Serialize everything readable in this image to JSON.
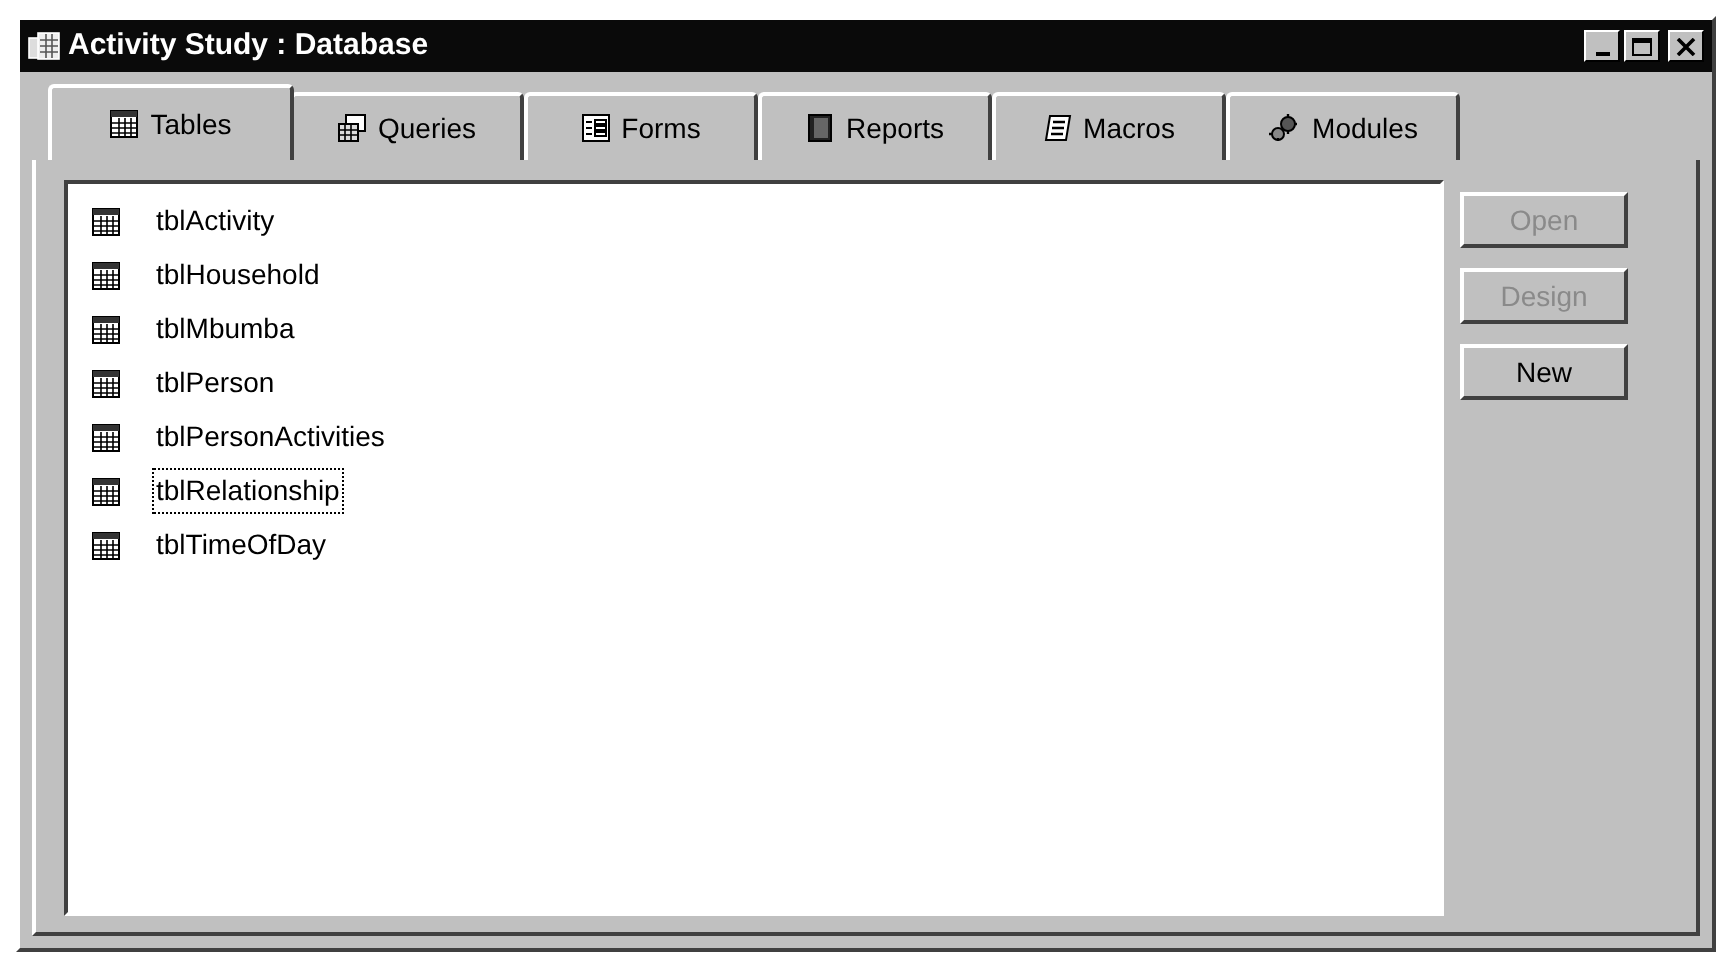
{
  "window": {
    "title": "Activity Study : Database"
  },
  "tabs": [
    {
      "label": "Tables",
      "kind": "tables",
      "selected": true
    },
    {
      "label": "Queries",
      "kind": "queries",
      "selected": false
    },
    {
      "label": "Forms",
      "kind": "forms",
      "selected": false
    },
    {
      "label": "Reports",
      "kind": "reports",
      "selected": false
    },
    {
      "label": "Macros",
      "kind": "macros",
      "selected": false
    },
    {
      "label": "Modules",
      "kind": "modules",
      "selected": false
    }
  ],
  "items": [
    {
      "label": "tblActivity",
      "selected": false
    },
    {
      "label": "tblHousehold",
      "selected": false
    },
    {
      "label": "tblMbumba",
      "selected": false
    },
    {
      "label": "tblPerson",
      "selected": false
    },
    {
      "label": "tblPersonActivities",
      "selected": false
    },
    {
      "label": "tblRelationship",
      "selected": true
    },
    {
      "label": "tblTimeOfDay",
      "selected": false
    }
  ],
  "buttons": [
    {
      "label": "Open",
      "disabled": true
    },
    {
      "label": "Design",
      "disabled": true
    },
    {
      "label": "New",
      "disabled": false
    }
  ]
}
